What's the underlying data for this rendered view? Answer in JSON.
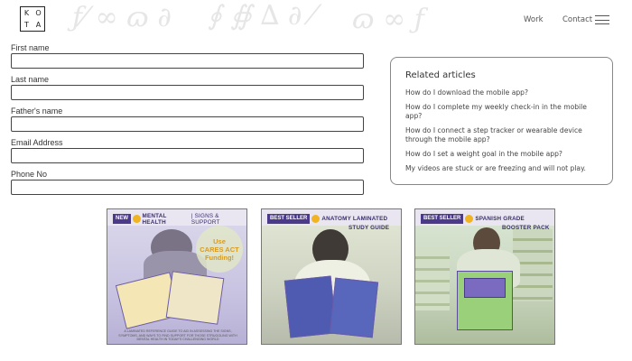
{
  "header": {
    "logo_letters": [
      "K",
      "O",
      "T",
      "A"
    ],
    "nav": {
      "work": "Work",
      "contact": "Contact"
    },
    "menu_icon": "hamburger-icon"
  },
  "form": {
    "fields": [
      {
        "label": "First name",
        "value": ""
      },
      {
        "label": "Last name",
        "value": ""
      },
      {
        "label": "Father's name",
        "value": ""
      },
      {
        "label": "Email Address",
        "value": ""
      },
      {
        "label": "Phone No",
        "value": ""
      }
    ]
  },
  "related": {
    "title": "Related articles",
    "items": [
      "How do I download the mobile app?",
      "How do I complete my weekly check-in in the mobile app?",
      "How do I connect a step tracker or wearable device through the mobile app?",
      "How do I set a weight goal in the mobile app?",
      "My videos are stuck or are freezing and will not play."
    ]
  },
  "products": [
    {
      "badge": "NEW",
      "title": "MENTAL HEALTH",
      "subtitle": "| SIGNS & SUPPORT",
      "cta_line1": "Use",
      "cta_line2": "CARES ACT",
      "cta_line3": "Funding!",
      "footnote": "A LAMINATED REFERENCE GUIDE TO AID IN ASSESSING THE SIGNS, SYMPTOMS, AND WAYS TO FIND SUPPORT FOR THOSE STRUGGLING WITH MENTAL HEALTH IN TODAY'S CHALLENGING WORLD"
    },
    {
      "badge": "BEST SELLER",
      "title": "ANATOMY LAMINATED",
      "subtitle": "STUDY GUIDE"
    },
    {
      "badge": "BEST SELLER",
      "title": "SPANISH GRADE",
      "subtitle": "BOOSTER PACK"
    }
  ],
  "colors": {
    "badge_bg": "#4b3a8a",
    "star": "#f0b322",
    "cta_text": "#d79b22"
  }
}
